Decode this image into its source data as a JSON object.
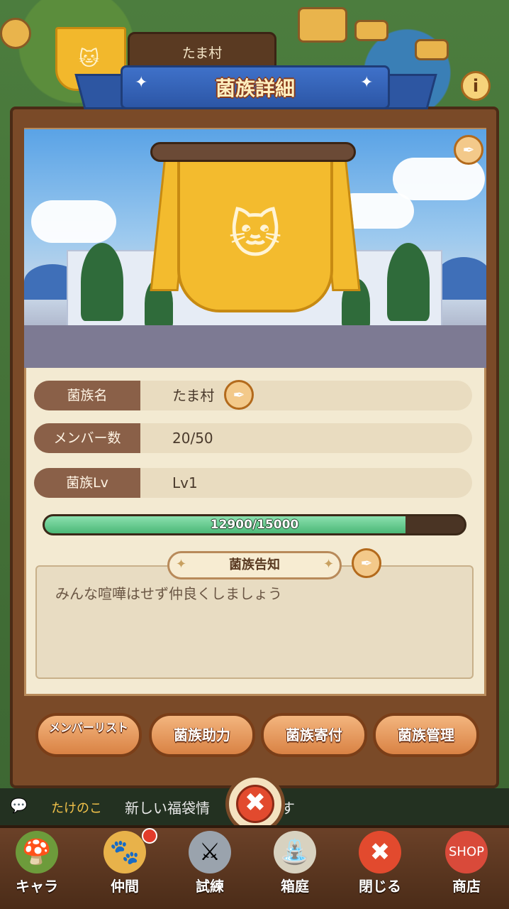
{
  "app": {
    "title": "菌族詳細"
  },
  "header": {
    "village_name_tag": "たま村",
    "title": "菌族詳細",
    "info_label": "i"
  },
  "clan": {
    "name_label": "菌族名",
    "name_value": "たま村",
    "members_label": "メンバー数",
    "members_value": "20/50",
    "level_label": "菌族Lv",
    "level_value": "Lv1",
    "exp_text": "12900/15000",
    "exp_fraction": 0.86
  },
  "notice": {
    "title": "菌族告知",
    "text": "みんな喧嘩はせず仲良くしましょう"
  },
  "actions": [
    {
      "label": "メンバーリスト"
    },
    {
      "label": "菌族助力"
    },
    {
      "label": "菌族寄付"
    },
    {
      "label": "菌族管理"
    }
  ],
  "chat": {
    "sender": "たけのこ",
    "message": "新しい福袋情　　　　ます"
  },
  "nav": [
    {
      "label": "キャラ",
      "icon": "mushroom-icon"
    },
    {
      "label": "仲間",
      "icon": "paw-icon"
    },
    {
      "label": "試練",
      "icon": "crossed-swords-icon"
    },
    {
      "label": "箱庭",
      "icon": "garden-icon"
    },
    {
      "label": "閉じる",
      "icon": "close-icon"
    },
    {
      "label": "商店",
      "icon": "shop-icon"
    }
  ],
  "colors": {
    "accent_blue": "#2c56a6",
    "panel_brown": "#7a4a28",
    "progress_green": "#4bb877",
    "button_orange": "#d98244",
    "close_red": "#e24a2e"
  }
}
